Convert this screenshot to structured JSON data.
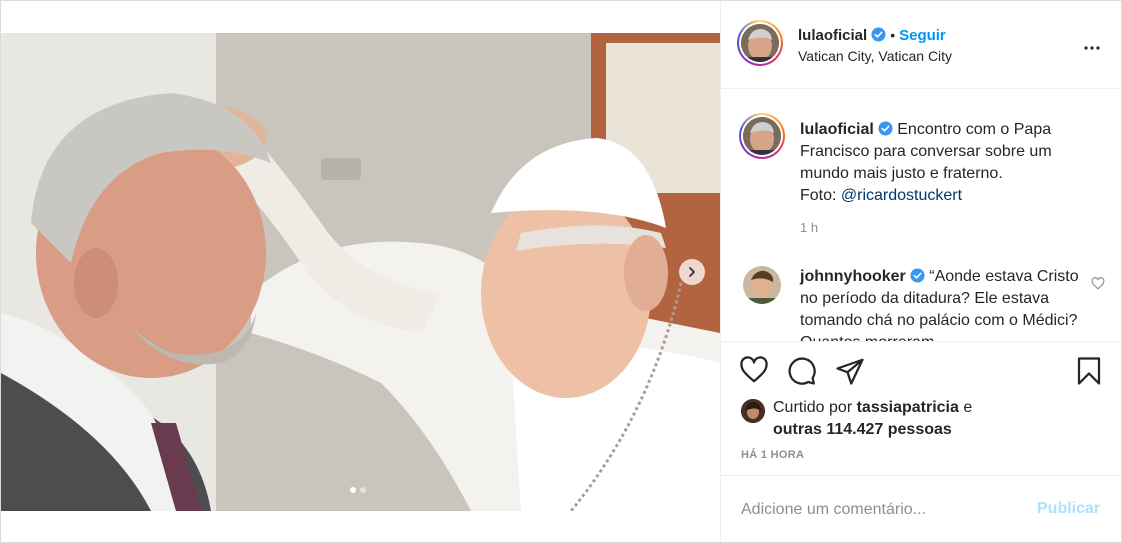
{
  "post": {
    "username": "lulaoficial",
    "follow_label": "Seguir",
    "bullet": "•",
    "location": "Vatican City, Vatican City",
    "more_icon": "more-horizontal-icon"
  },
  "caption": {
    "username": "lulaoficial",
    "text": "Encontro com o Papa Francisco para conversar sobre um mundo mais justo e fraterno.",
    "photo_prefix": "Foto: ",
    "mention": "@ricardostuckert",
    "time": "1 h"
  },
  "comment": {
    "username": "johnnyhooker",
    "text": "“Aonde estava Cristo no período da ditadura? Ele estava tomando chá no palácio com o Médici? Quantos morreram",
    "like_icon": "heart-outline-icon"
  },
  "actions": {
    "like_icon": "heart-outline-icon",
    "comment_icon": "comment-bubble-icon",
    "share_icon": "paper-plane-icon",
    "save_icon": "bookmark-icon"
  },
  "likes": {
    "prefix": "Curtido por ",
    "user": "tassiapatricia",
    "connector": " e",
    "others": "outras 114.427 pessoas"
  },
  "timestamp": "HÁ 1 HORA",
  "add_comment": {
    "placeholder": "Adicione um comentário...",
    "publish_label": "Publicar"
  },
  "carousel": {
    "total_slides": 2,
    "current_slide": 1,
    "next_icon": "chevron-right-icon"
  },
  "colors": {
    "accent": "#0095f6",
    "mention": "#00376b",
    "muted": "#8e8e8e",
    "publish_disabled": "#b2dffc",
    "verified": "#3897f0"
  }
}
